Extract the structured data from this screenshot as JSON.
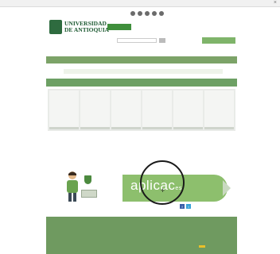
{
  "browser": {
    "url": "",
    "close": "×"
  },
  "header": {
    "topbar_items": [
      "",
      "",
      "",
      ""
    ],
    "university_name_line1": "UNIVERSIDAD",
    "university_name_line2": "DE ANTIOQUIA",
    "access_button": "",
    "language": "",
    "search_label": "",
    "directory_button": ""
  },
  "nav": {
    "items": [
      "",
      "",
      "",
      "",
      "",
      "",
      "",
      ""
    ]
  },
  "breadcrumb": "",
  "page_title": "",
  "tiles": [
    {
      "big": "",
      "text": ""
    },
    {
      "big": "",
      "text": ""
    },
    {
      "big": "",
      "text": ""
    },
    {
      "big": "",
      "text": ""
    },
    {
      "big": "",
      "text": ""
    },
    {
      "big": "",
      "text": ""
    }
  ],
  "apps": {
    "heading": "",
    "banner_text": "aplicac",
    "banner_text_tail": "es"
  },
  "share": {
    "label": ""
  },
  "footer": {
    "columns": [
      {
        "title": "",
        "links": [
          "",
          "",
          ""
        ]
      },
      {
        "title": "",
        "links": [
          "",
          "",
          ""
        ]
      },
      {
        "title": "",
        "links": [
          "",
          "",
          ""
        ]
      },
      {
        "title": "",
        "links": [
          "",
          "",
          ""
        ]
      }
    ]
  },
  "colors": {
    "brand_green": "#2e6b3f",
    "nav_green": "#7ca368",
    "banner_green": "#8dbf6d",
    "footer_green": "#6f9a60"
  }
}
